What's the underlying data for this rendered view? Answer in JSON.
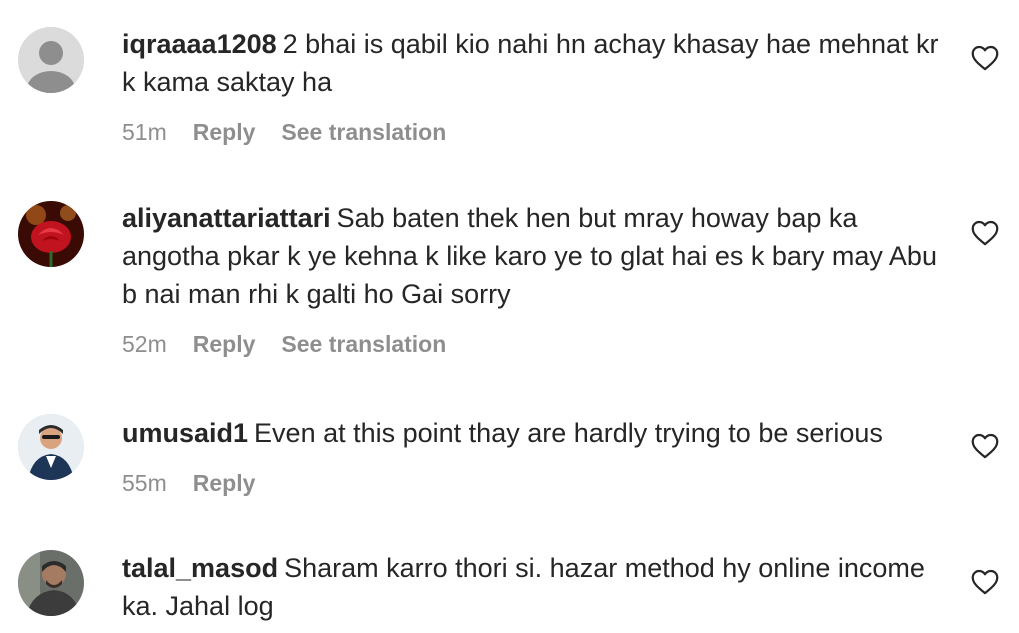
{
  "comments": [
    {
      "username": "iqraaaa1208",
      "text": "2 bhai is qabil kio nahi hn achay khasay hae mehnat kr k kama saktay ha",
      "time": "51m",
      "reply": "Reply",
      "translate": "See translation",
      "avatar": "default-avatar"
    },
    {
      "username": "aliyanattariattari",
      "text": "Sab baten thek hen but mray howay bap ka angotha pkar k ye kehna k like karo ye to glat hai es k bary may Abu b nai man rhi k galti ho Gai sorry",
      "time": "52m",
      "reply": "Reply",
      "translate": "See translation",
      "avatar": "rose-photo"
    },
    {
      "username": "umusaid1",
      "text": "Even at this point thay are hardly trying to be serious",
      "time": "55m",
      "reply": "Reply",
      "avatar": "person-photo"
    },
    {
      "username": "talal_masod",
      "text": "Sharam karro thori si. hazar method hy online income ka. Jahal log",
      "avatar": "person-photo-dark"
    }
  ],
  "icons": {
    "like": "heart-outline-icon"
  },
  "colors": {
    "text": "#262626",
    "meta": "#8e8e8e",
    "background": "#ffffff"
  }
}
